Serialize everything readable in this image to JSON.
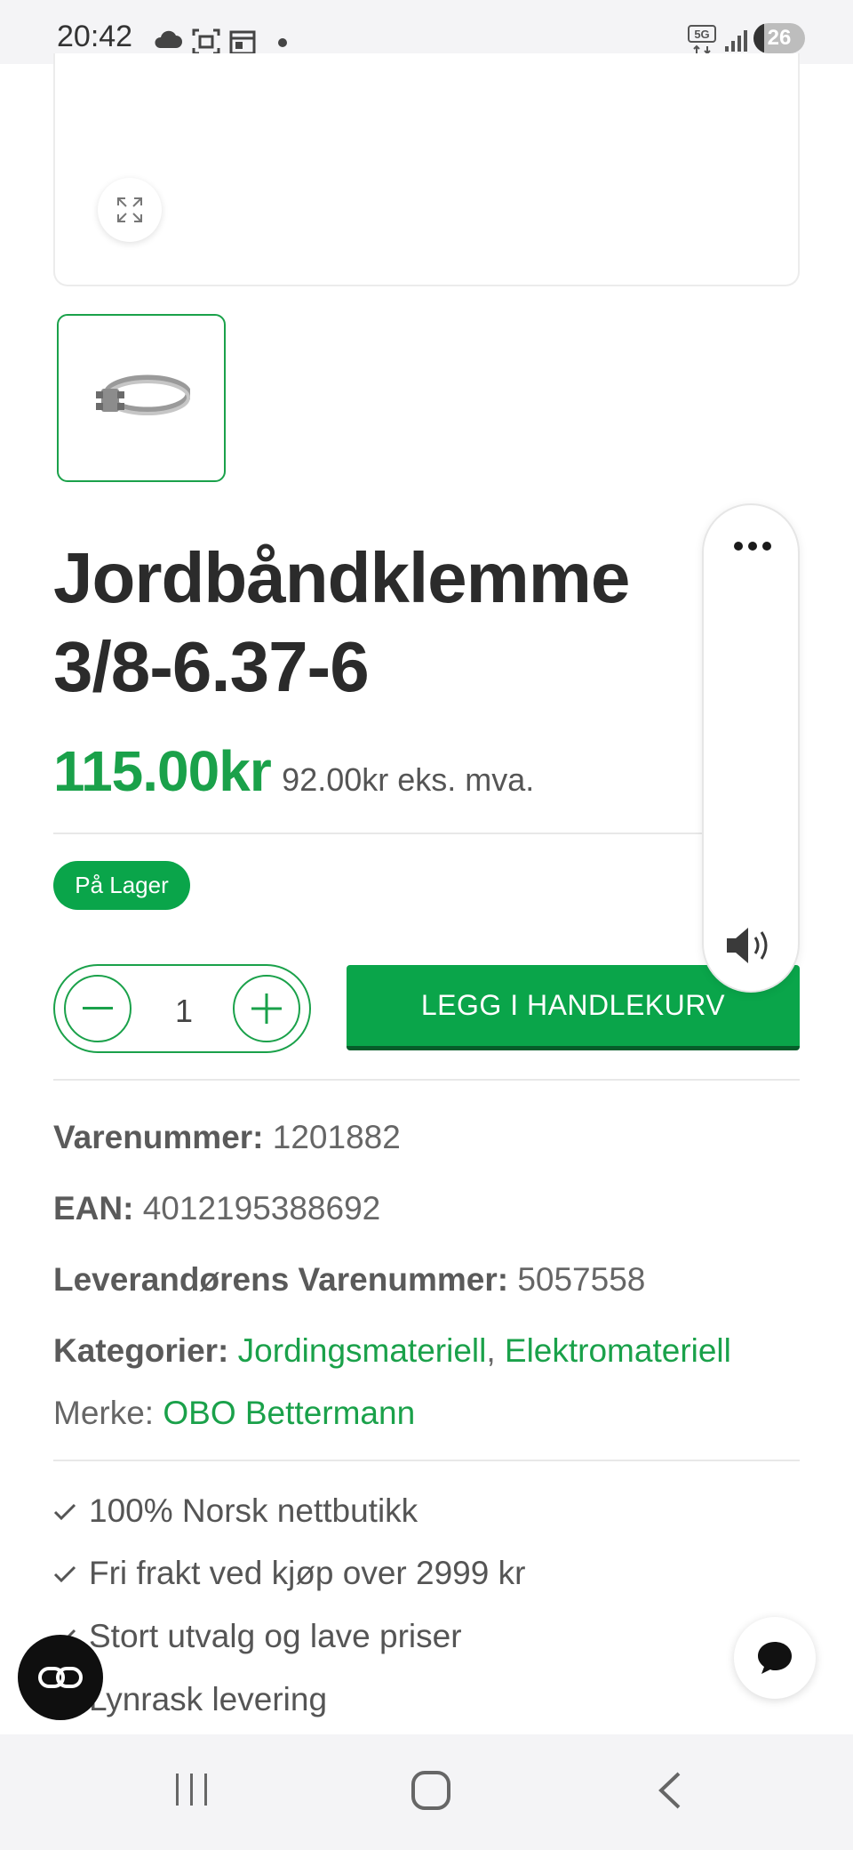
{
  "status_bar": {
    "time": "20:42",
    "icons": [
      "cloud-icon",
      "screenshot-icon",
      "calendar-icon",
      "dot-icon",
      "5g-icon",
      "signal-icon"
    ],
    "battery": "26"
  },
  "product": {
    "gallery": {
      "expand_icon": "expand-icon",
      "thumbnail_alt": "Jordbåndklemme thumbnail"
    },
    "title": "Jordbåndklemme 3/8-6.37-6",
    "price": "115.00kr",
    "price_ex_vat": "92.00kr eks. mva.",
    "stock_label": "På Lager",
    "quantity": "1",
    "add_to_cart_label": "LEGG I HANDLEKURV"
  },
  "details": {
    "varenummer_label": "Varenummer:",
    "varenummer": "1201882",
    "ean_label": "EAN:",
    "ean": "4012195388692",
    "supplier_label": "Leverandørens Varenummer:",
    "supplier_number": "5057558",
    "categories_label": "Kategorier:",
    "categories": [
      "Jordingsmateriell",
      "Elektromateriell"
    ],
    "category_separator": ",",
    "brand_label": "Merke:",
    "brand": "OBO Bettermann"
  },
  "usps": [
    "100% Norsk nettbutikk",
    "Fri frakt ved kjøp over 2999 kr",
    "Stort utvalg og lave priser",
    "Lynrask levering"
  ],
  "colors": {
    "brand_green": "#1aa14a",
    "button_green": "#0aa54a"
  }
}
